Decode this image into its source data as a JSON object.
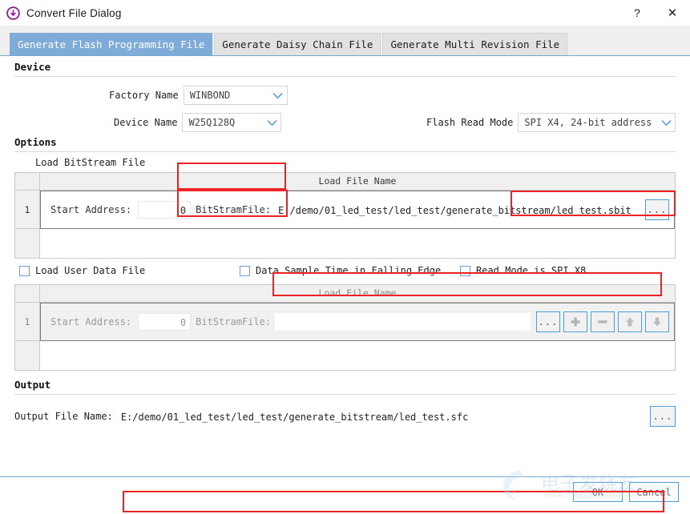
{
  "window": {
    "title": "Convert File Dialog",
    "icon": "download-circle-icon",
    "help_label": "?",
    "close_label": "✕"
  },
  "tabs": [
    {
      "label": "Generate Flash Programming File",
      "active": true
    },
    {
      "label": "Generate Daisy Chain File",
      "active": false
    },
    {
      "label": "Generate Multi Revision File",
      "active": false
    }
  ],
  "device": {
    "section_title": "Device",
    "factory_name_label": "Factory Name",
    "factory_name_value": "WINBOND",
    "device_name_label": "Device Name",
    "device_name_value": "W25Q128Q",
    "flash_read_mode_label": "Flash Read Mode",
    "flash_read_mode_value": "SPI X4, 24-bit address"
  },
  "options": {
    "section_title": "Options",
    "bitstream_caption": "Load BitStream File",
    "column_header": "Load File Name",
    "row_number": "1",
    "start_address_label": "Start Address:",
    "start_address_value": "0",
    "bitstream_file_label": "BitStramFile:",
    "bitstream_file_value": "E:/demo/01_led_test/led_test/generate_bitstream/led_test.sbit",
    "browse_label": "..."
  },
  "checkboxes": [
    {
      "label": "Load User Data File",
      "checked": false
    },
    {
      "label": "Data Sample Time in Falling Edge",
      "checked": false
    },
    {
      "label": "Read Mode is SPI X8",
      "checked": false
    }
  ],
  "userdata": {
    "column_header": "Load File Name",
    "row_number": "1",
    "start_address_label": "Start Address:",
    "start_address_value": "0",
    "bitstream_file_label": "BitStramFile:",
    "bitstream_file_value": "",
    "browse_label": "...",
    "add_label": "add-icon",
    "remove_label": "remove-icon",
    "up_label": "move-up-icon",
    "down_label": "move-down-icon"
  },
  "output": {
    "section_title": "Output",
    "file_name_label": "Output File Name:",
    "file_name_value": "E:/demo/01_led_test/led_test/generate_bitstream/led_test.sfc",
    "browse_label": "..."
  },
  "footer": {
    "ok_label": "OK",
    "cancel_label": "Cancel"
  },
  "watermark": {
    "text_cn": "电子发烧友",
    "text_url": "www.elecfans.com"
  },
  "colors": {
    "accent_blue": "#7eabd8",
    "annotation_red": "#ee2222",
    "title_icon_purple": "#8e1b8e",
    "button_border_blue": "#4a9fd8"
  }
}
